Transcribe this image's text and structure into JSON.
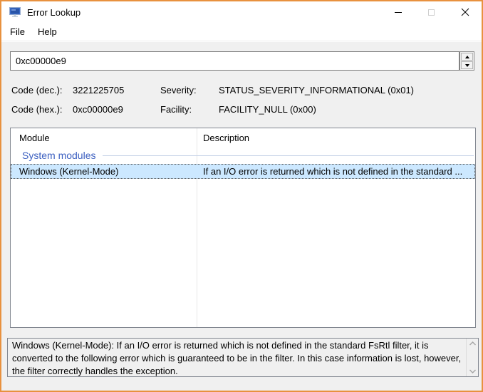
{
  "window": {
    "title": "Error Lookup"
  },
  "menu": {
    "items": [
      {
        "label": "File"
      },
      {
        "label": "Help"
      }
    ]
  },
  "code_input": {
    "value": "0xc00000e9"
  },
  "info": {
    "code_dec_label": "Code (dec.):",
    "code_dec_value": "3221225705",
    "code_hex_label": "Code (hex.):",
    "code_hex_value": "0xc00000e9",
    "severity_label": "Severity:",
    "severity_value": "STATUS_SEVERITY_INFORMATIONAL (0x01)",
    "facility_label": "Facility:",
    "facility_value": "FACILITY_NULL (0x00)"
  },
  "results": {
    "columns": [
      {
        "label": "Module"
      },
      {
        "label": "Description"
      }
    ],
    "group_label": "System modules",
    "rows": [
      {
        "module": "Windows (Kernel-Mode)",
        "description": "If an I/O error is returned which is not defined in the standard ...",
        "selected": true
      }
    ]
  },
  "detail": {
    "text": "Windows (Kernel-Mode): If an I/O error is returned which is not defined in the standard FsRtl filter, it is converted to the following error which is guaranteed to be in the filter. In this case information is lost, however, the filter correctly handles the exception."
  },
  "colors": {
    "accent_border": "#e8913f",
    "selection_bg": "#cce8ff",
    "group_header_text": "#3b5fc0"
  }
}
